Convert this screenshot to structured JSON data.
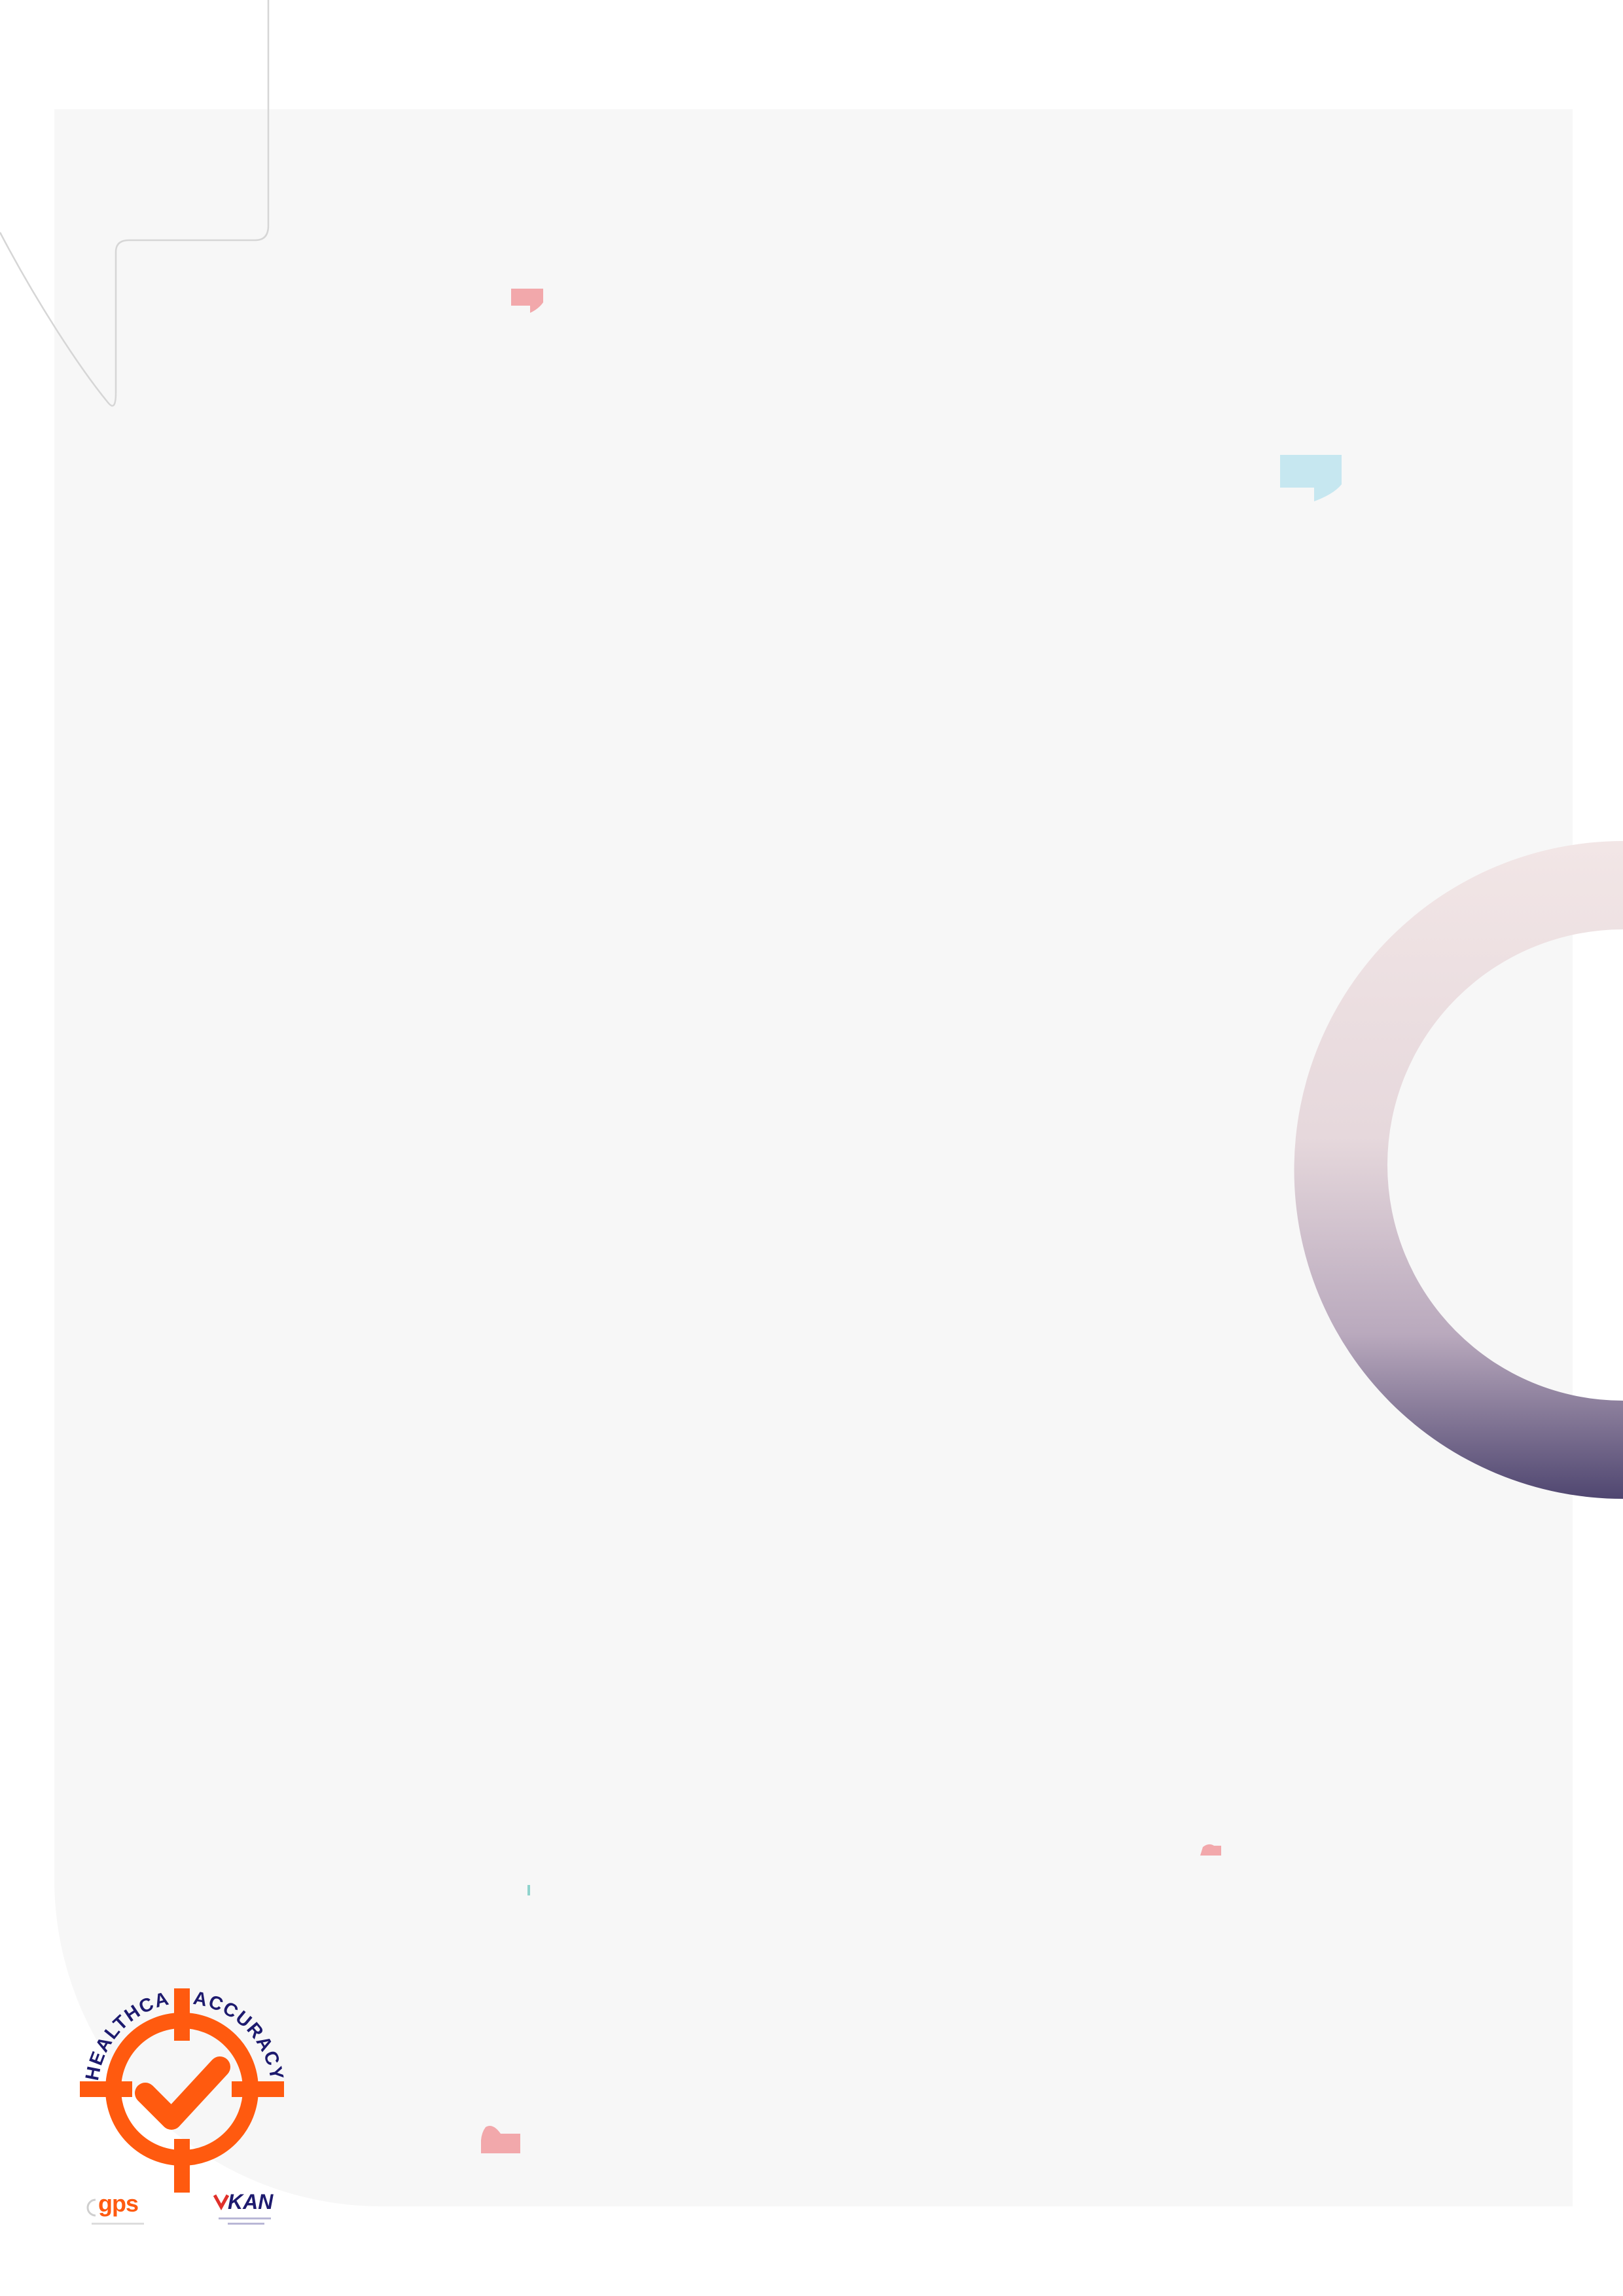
{
  "colors": {
    "page_background": "#ffffff",
    "panel_background": "#f7f7f7",
    "accent_orange": "#ff5a0f",
    "accent_navy": "#1d1a6e",
    "pink_mark": "#f2a8ab",
    "cyan_mark": "#c6e7f0",
    "ring_light": "#f2e6e6",
    "ring_dark": "#4f4670"
  },
  "badge": {
    "icon": "target-check-icon",
    "arc_left_text": "HEALTHCARE",
    "arc_right_text": "ACCURACY"
  },
  "logos": {
    "gps": {
      "icon": "gps-logo-icon",
      "text": "gps"
    },
    "kan": {
      "icon": "kan-logo-icon",
      "text": "KAN"
    }
  }
}
